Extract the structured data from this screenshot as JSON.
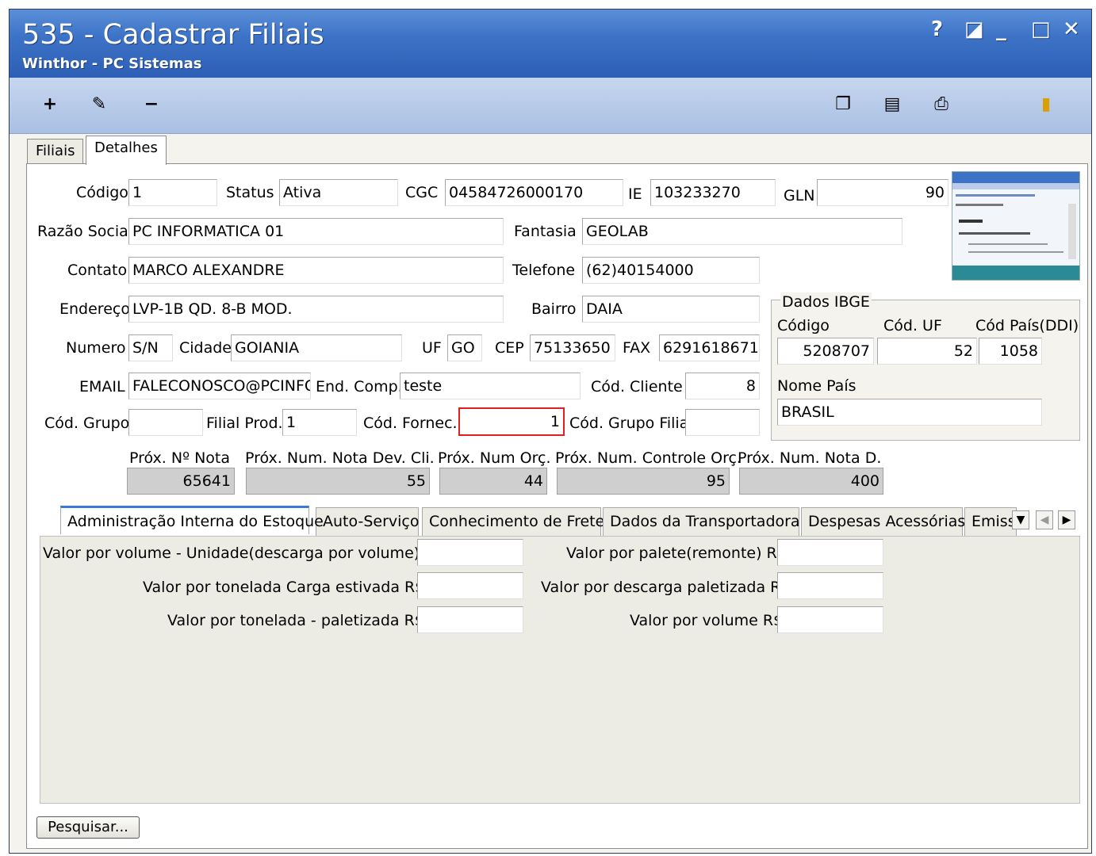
{
  "window": {
    "title": "535 - Cadastrar Filiais",
    "subtitle": "Winthor - PC Sistemas",
    "help": "?",
    "restore": "◪",
    "minimize": "_",
    "maximize": "□",
    "close": "✕"
  },
  "toolbar": {
    "add": "+",
    "edit": "✎",
    "remove": "−",
    "copy": "❐",
    "notes": "▤",
    "print": "⎙",
    "exit": "▮"
  },
  "top_tabs": [
    "Filiais",
    "Detalhes"
  ],
  "form": {
    "codigo_label": "Código",
    "codigo": "1",
    "status_label": "Status",
    "status": "Ativa",
    "cgc_label": "CGC",
    "cgc": "04584726000170",
    "ie_label": "IE",
    "ie": "103233270",
    "gln_label": "GLN",
    "gln": "90",
    "razao_label": "Razão Social",
    "razao": "PC INFORMATICA 01",
    "fantasia_label": "Fantasia",
    "fantasia": "GEOLAB",
    "contato_label": "Contato",
    "contato": "MARCO ALEXANDRE",
    "telefone_label": "Telefone",
    "telefone": "(62)40154000",
    "endereco_label": "Endereço",
    "endereco": "LVP-1B QD. 8-B MOD.",
    "bairro_label": "Bairro",
    "bairro": "DAIA",
    "numero_label": "Numero",
    "numero": "S/N",
    "cidade_label": "Cidade",
    "cidade": "GOIANIA",
    "uf_label": "UF",
    "uf": "GO",
    "cep_label": "CEP",
    "cep": "75133650",
    "fax_label": "FAX",
    "fax": "6291618671",
    "email_label": "EMAIL",
    "email": "FALECONOSCO@PCINFOI",
    "endcomp_label": "End. Comp.",
    "endcomp": "teste",
    "codcliente_label": "Cód. Cliente",
    "codcliente": "8",
    "codgrupo_label": "Cód. Grupo",
    "codgrupo": "",
    "filialprod_label": "Filial Prod.",
    "filialprod": "1",
    "codfornec_label": "Cód. Fornec.",
    "codfornec": "1",
    "codgrupofilial_label": "Cód. Grupo Filial",
    "codgrupofilial": ""
  },
  "ibge": {
    "title": "Dados IBGE",
    "codigo_label": "Código",
    "codigo": "5208707",
    "coduf_label": "Cód. UF",
    "coduf": "52",
    "codpais_label": "Cód País(DDI)",
    "codpais": "1058",
    "nomepais_label": "Nome País",
    "nomepais": "BRASIL"
  },
  "counters": {
    "prox_nota_label": "Próx. Nº Nota",
    "prox_nota": "65641",
    "prox_dev_label": "Próx. Num. Nota Dev. Cli.",
    "prox_dev": "55",
    "prox_orc_label": "Próx. Num Orç.",
    "prox_orc": "44",
    "prox_ctrl_label": "Próx. Num. Controle Orç.",
    "prox_ctrl": "95",
    "prox_d_label": "Próx. Num. Nota D.",
    "prox_d": "400"
  },
  "inner_tabs": [
    "Administração Interna do Estoque",
    "Auto-Serviço",
    "Conhecimento de Frete",
    "Dados da Transportadora",
    "Despesas Acessórias",
    "Emiss"
  ],
  "inner_nav": {
    "down": "▼",
    "left": "◀",
    "right": "▶"
  },
  "estoque": {
    "valor_volume_unidade_label": "Valor por volume - Unidade(descarga por volume)R$:",
    "valor_tonelada_estivada_label": "Valor por tonelada Carga estivada R$:",
    "valor_tonelada_paletizada_label": "Valor por tonelada - paletizada R$:",
    "valor_palete_label": "Valor por palete(remonte) R$:",
    "valor_descarga_paletizada_label": "Valor por descarga paletizada R$:",
    "valor_volume_label": "Valor por volume R$:"
  },
  "pesquisar": "Pesquisar..."
}
